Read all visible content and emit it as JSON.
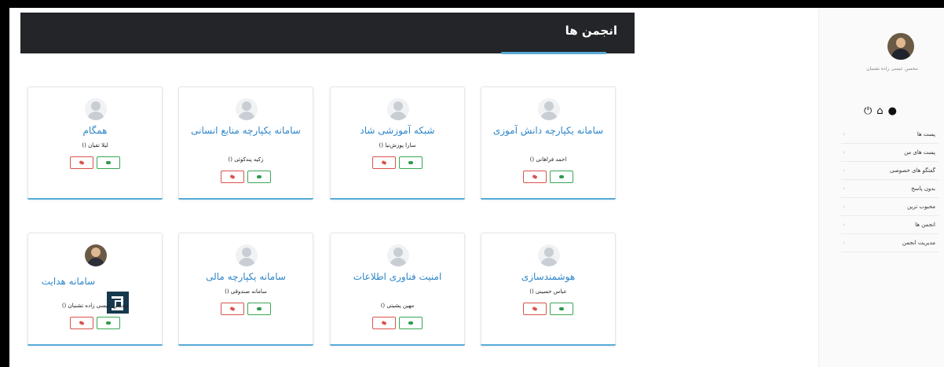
{
  "header": {
    "title": "انجمن ها"
  },
  "cards": [
    {
      "title": "سامانه یکپارچه دانش آموزی",
      "author": "احمد فراهانی ()"
    },
    {
      "title": "شبکه آموزشی شاد",
      "author": "سارا پوزش‌نیا ()"
    },
    {
      "title": "سامانه یکپارچه منابع انسانی",
      "author": "زکیه پندکوئی ()"
    },
    {
      "title": "همگام",
      "author": "لیلا تقیان ()"
    },
    {
      "title": "هوشمندسازی",
      "author": "عباس حسینی ()"
    },
    {
      "title": "امنیت فناوری اطلاعات",
      "author": "مهین پشیتی ()"
    },
    {
      "title": "سامانه یکپارچه مالی",
      "author": "سامانه صندوقی ()"
    },
    {
      "title": "سامانه هدایت",
      "author": "محسن عیسی زاده تشنیان ()"
    }
  ],
  "sidebar": {
    "profile_name": "محسن عیسی زاده تشنیان",
    "icons": [
      "power-icon",
      "home-icon",
      "chat-icon"
    ],
    "menu": [
      "پست ها",
      "پست های من",
      "گفتگو های خصوصی",
      "بدون پاسخ",
      "محبوب ترین",
      "انجمن ها",
      "مدیریت انجمن"
    ]
  },
  "colors": {
    "header_bg": "#232528",
    "accent": "#56abd9",
    "title_blue": "#2f86c9"
  }
}
